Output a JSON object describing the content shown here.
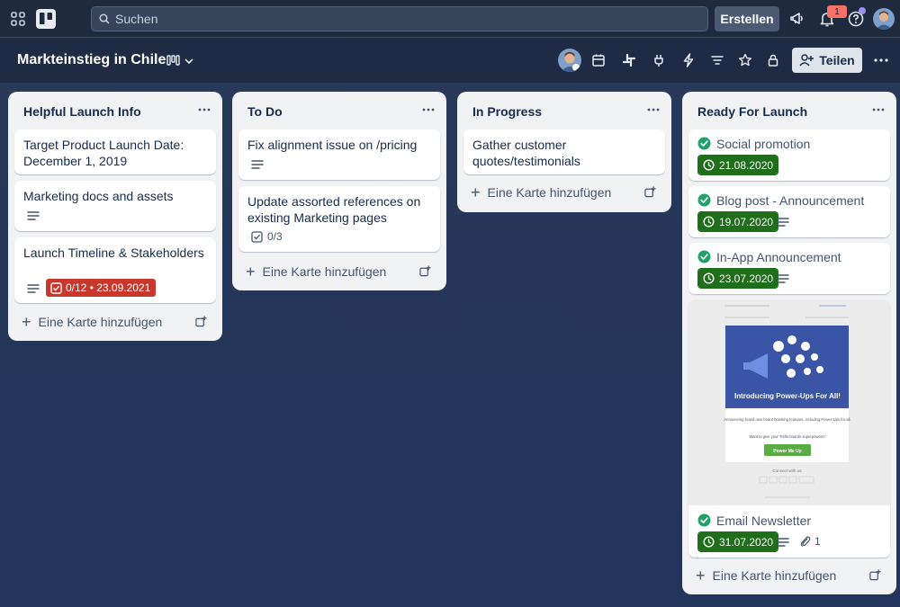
{
  "topbar": {
    "search_placeholder": "Suchen",
    "create_label": "Erstellen",
    "notification_count": "1",
    "icons": [
      "apps-icon",
      "trello-logo",
      "search-icon",
      "megaphone-icon",
      "bell-icon",
      "help-icon",
      "avatar"
    ]
  },
  "board": {
    "title": "Markteinstieg in Chile",
    "share_label": "Teilen",
    "toolbar_icons": [
      "avatar",
      "calendar-icon",
      "slack-icon",
      "power-up-icon",
      "automation-icon",
      "filter-icon",
      "star-icon",
      "lock-icon",
      "more-icon"
    ]
  },
  "colors": {
    "accent_red": "#c9372c",
    "accent_green": "#1f6f1a",
    "done_green": "#22a06b",
    "list_bg": "#f1f2f4"
  },
  "add_card_label": "Eine Karte hinzufügen",
  "lists": [
    {
      "title": "Helpful Launch Info",
      "cards": [
        {
          "title": "Target Product Launch Date: December 1, 2019"
        },
        {
          "title": "Marketing docs and assets"
        },
        {
          "title": "Launch Timeline & Stakeholders",
          "badge": "0/12 • 23.09.2021"
        }
      ]
    },
    {
      "title": "To Do",
      "cards": [
        {
          "title": "Fix alignment issue on /pricing"
        },
        {
          "title": "Update assorted references on existing Marketing pages",
          "checklist": "0/3"
        }
      ]
    },
    {
      "title": "In Progress",
      "cards": [
        {
          "title": "Gather customer quotes/testimonials"
        }
      ]
    },
    {
      "title": "Ready For Launch",
      "cards": [
        {
          "title": "Social promotion",
          "date": "21.08.2020"
        },
        {
          "title": "Blog post - Announcement",
          "date": "19.07.2020"
        },
        {
          "title": "In-App Announcement",
          "date": "23.07.2020"
        },
        {
          "title": "Email Newsletter",
          "date": "31.07.2020",
          "attachments": "1"
        }
      ]
    }
  ],
  "newsletter_cover": {
    "brand": "Trello",
    "headline": "Introducing Power-Ups For All!",
    "body1": "Announcing brand new board boosting features, including Power-Ups for all.",
    "body2": "Want to give your Trello boards superpowers?",
    "cta": "Power Me Up",
    "connect": "Connect with us:",
    "blog": "Blog"
  }
}
